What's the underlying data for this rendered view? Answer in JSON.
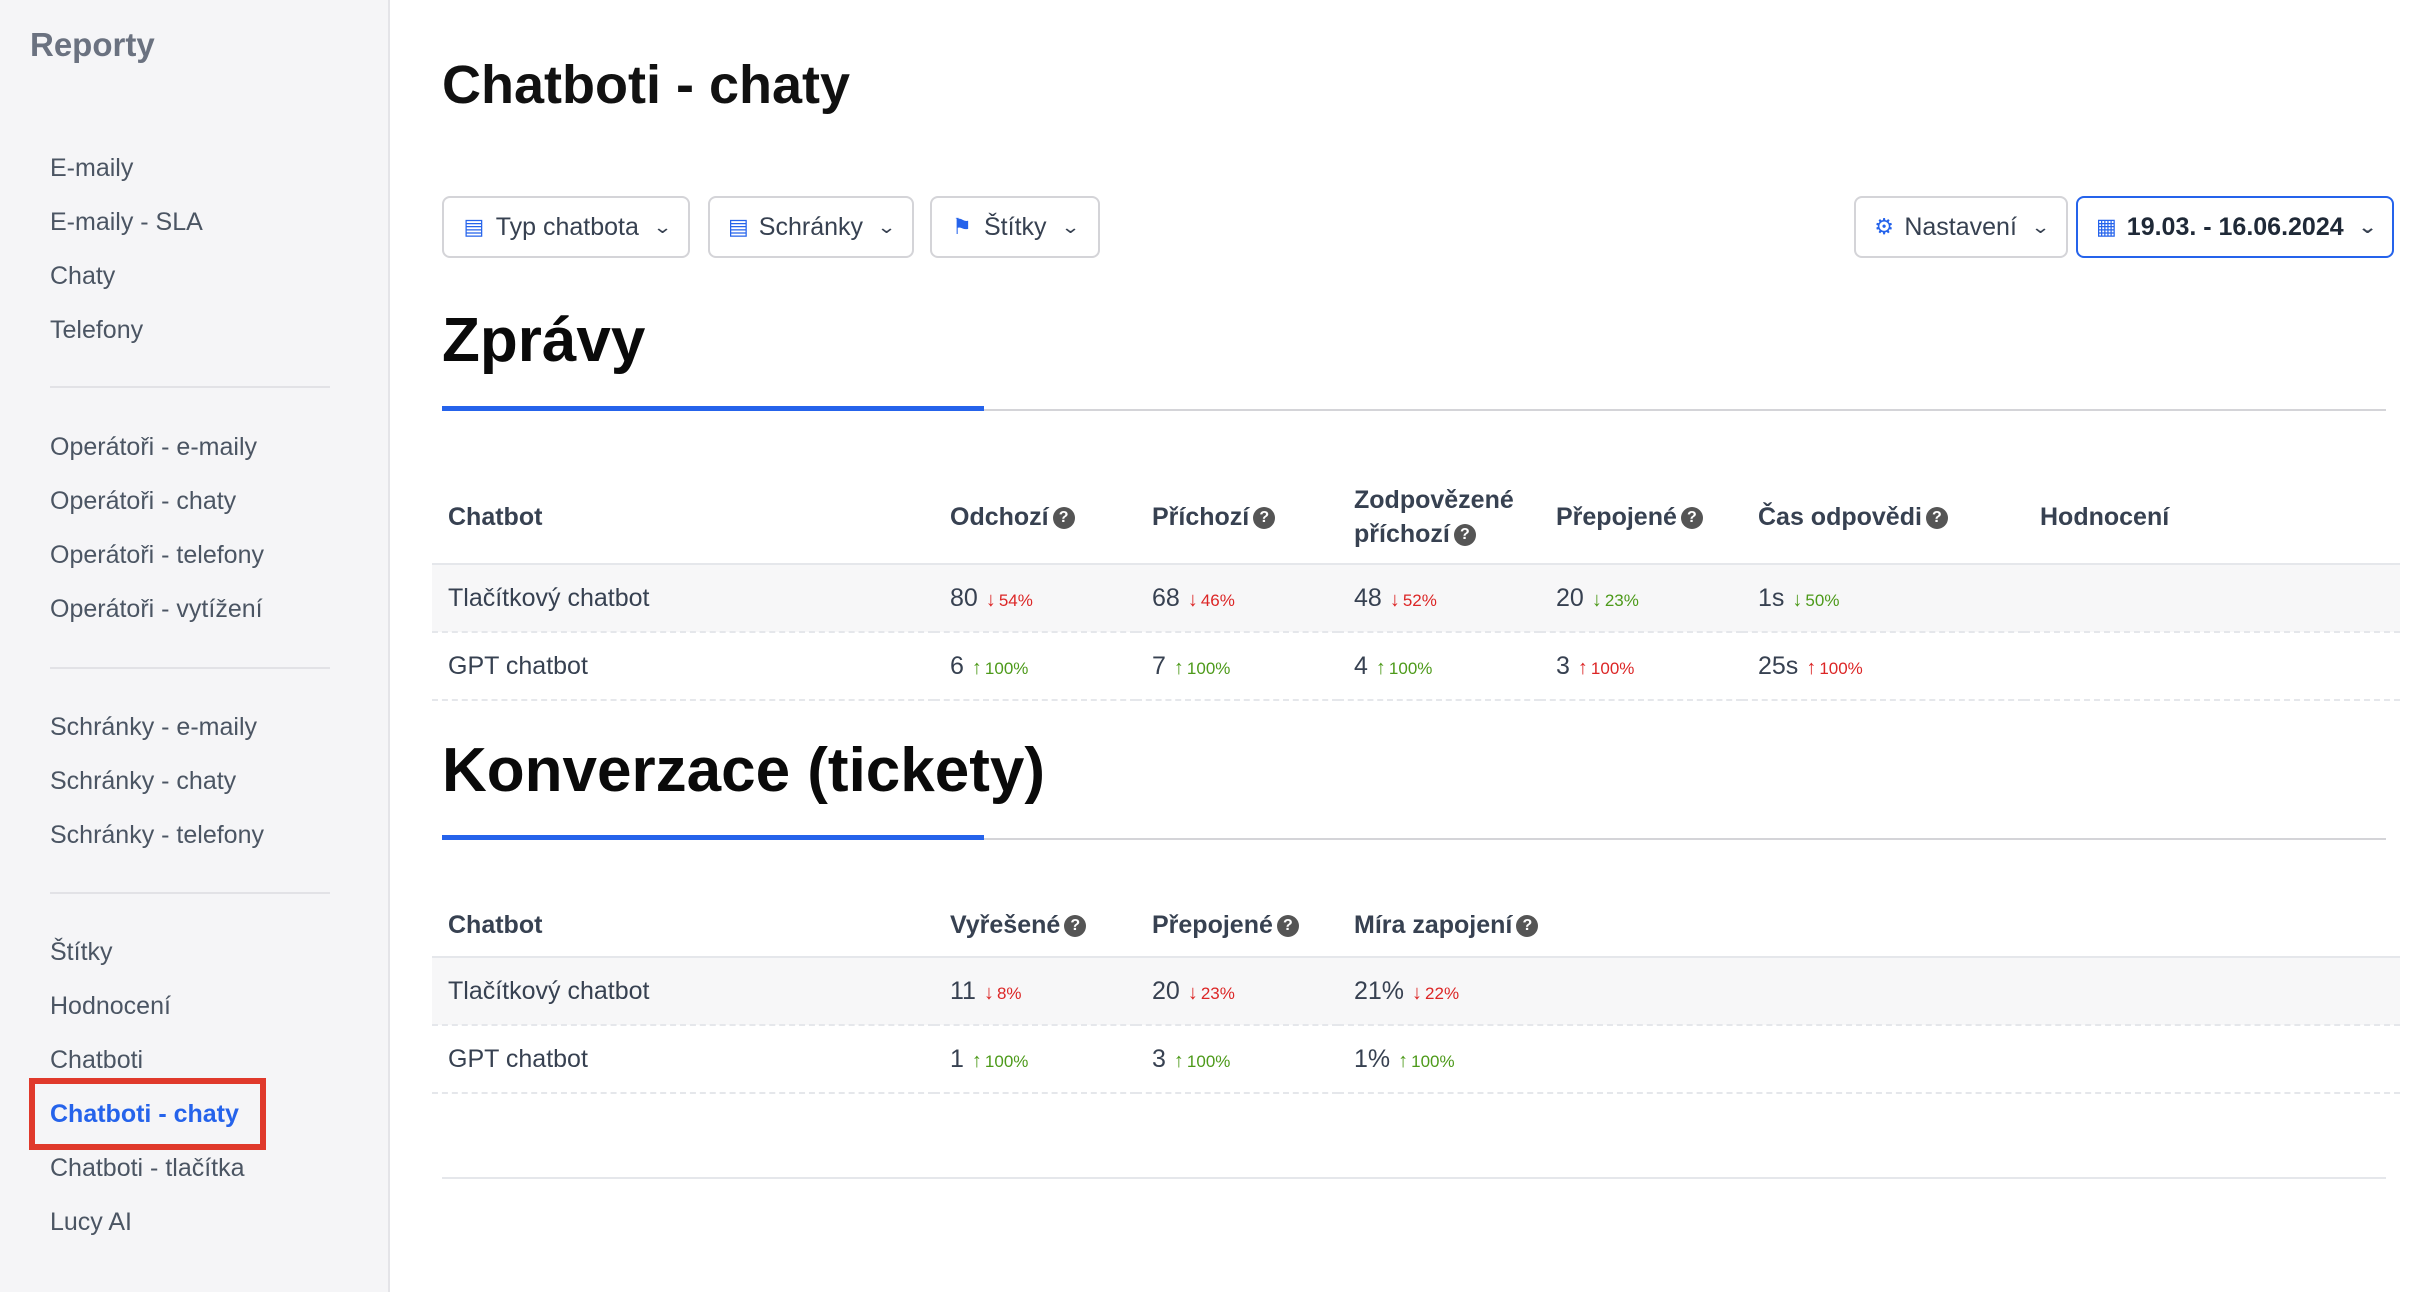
{
  "sidebar": {
    "title": "Reporty",
    "groups": [
      [
        "E-maily",
        "E-maily - SLA",
        "Chaty",
        "Telefony"
      ],
      [
        "Operátoři - e-maily",
        "Operátoři - chaty",
        "Operátoři - telefony",
        "Operátoři - vytížení"
      ],
      [
        "Schránky - e-maily",
        "Schránky - chaty",
        "Schránky - telefony"
      ],
      [
        "Štítky",
        "Hodnocení",
        "Chatboti",
        "Chatboti - chaty",
        "Chatboti - tlačítka",
        "Lucy AI"
      ]
    ],
    "active": "Chatboti - chaty"
  },
  "page": {
    "title": "Chatboti - chaty"
  },
  "filters": {
    "type": "Typ chatbota",
    "boxes": "Schránky",
    "tags": "Štítky",
    "settings": "Nastavení",
    "date": "19.03. - 16.06.2024"
  },
  "colors": {
    "accent": "#2563eb",
    "negative": "#dc2626",
    "positive": "#4d9a1a",
    "highlight": "#e0392b"
  },
  "messages": {
    "title": "Zprávy",
    "headers": [
      "Chatbot",
      "Odchozí",
      "Příchozí",
      "Zodpovězené příchozí",
      "Přepojené",
      "Čas odpovědi",
      "Hodnocení"
    ],
    "rows": [
      {
        "name": "Tlačítkový chatbot",
        "cells": [
          {
            "v": "80",
            "d": "54%",
            "dir": "down",
            "tone": "down"
          },
          {
            "v": "68",
            "d": "46%",
            "dir": "down",
            "tone": "down"
          },
          {
            "v": "48",
            "d": "52%",
            "dir": "down",
            "tone": "down"
          },
          {
            "v": "20",
            "d": "23%",
            "dir": "down",
            "tone": "up-good"
          },
          {
            "v": "1s",
            "d": "50%",
            "dir": "down",
            "tone": "up-good"
          },
          {
            "v": "",
            "d": "",
            "dir": "",
            "tone": ""
          }
        ]
      },
      {
        "name": "GPT chatbot",
        "cells": [
          {
            "v": "6",
            "d": "100%",
            "dir": "up",
            "tone": "up-good"
          },
          {
            "v": "7",
            "d": "100%",
            "dir": "up",
            "tone": "up-good"
          },
          {
            "v": "4",
            "d": "100%",
            "dir": "up",
            "tone": "up-good"
          },
          {
            "v": "3",
            "d": "100%",
            "dir": "up",
            "tone": "up-bad"
          },
          {
            "v": "25s",
            "d": "100%",
            "dir": "up",
            "tone": "up-bad"
          },
          {
            "v": "",
            "d": "",
            "dir": "",
            "tone": ""
          }
        ]
      }
    ]
  },
  "conversions": {
    "title": "Konverzace (tickety)",
    "headers": [
      "Chatbot",
      "Vyřešené",
      "Přepojené",
      "Míra zapojení"
    ],
    "rows": [
      {
        "name": "Tlačítkový chatbot",
        "cells": [
          {
            "v": "11",
            "d": "8%",
            "dir": "down",
            "tone": "down"
          },
          {
            "v": "20",
            "d": "23%",
            "dir": "down",
            "tone": "down"
          },
          {
            "v": "21%",
            "d": "22%",
            "dir": "down",
            "tone": "down"
          }
        ]
      },
      {
        "name": "GPT chatbot",
        "cells": [
          {
            "v": "1",
            "d": "100%",
            "dir": "up",
            "tone": "up-good"
          },
          {
            "v": "3",
            "d": "100%",
            "dir": "up",
            "tone": "up-good"
          },
          {
            "v": "1%",
            "d": "100%",
            "dir": "up",
            "tone": "up-good"
          }
        ]
      }
    ]
  }
}
